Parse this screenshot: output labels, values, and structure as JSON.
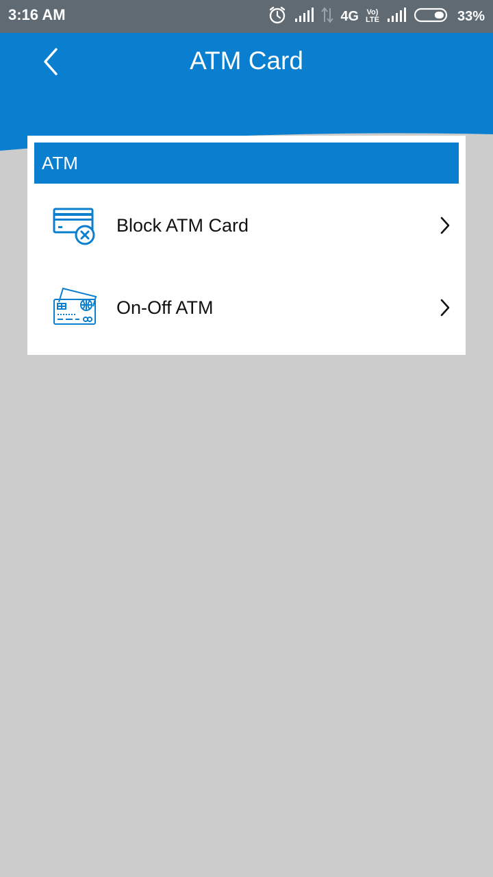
{
  "status_bar": {
    "time": "3:16 AM",
    "network": "4G",
    "volte_top": "Vo)",
    "volte_bottom": "LTE",
    "battery_percent": "33%",
    "battery_level": 0.33,
    "icons": [
      "alarm-icon",
      "signal-icon",
      "data-arrows-icon",
      "volte-icon",
      "signal-icon",
      "battery-icon"
    ]
  },
  "header": {
    "title": "ATM Card",
    "back_icon": "chevron-left-icon"
  },
  "section": {
    "title": "ATM",
    "items": [
      {
        "label": "Block ATM Card",
        "icon": "card-block-icon"
      },
      {
        "label": "On-Off ATM",
        "icon": "card-toggle-icon"
      }
    ]
  },
  "colors": {
    "status_bar": "#5f6a73",
    "primary": "#0a7fcf",
    "background": "#cccccc",
    "card": "#ffffff"
  }
}
